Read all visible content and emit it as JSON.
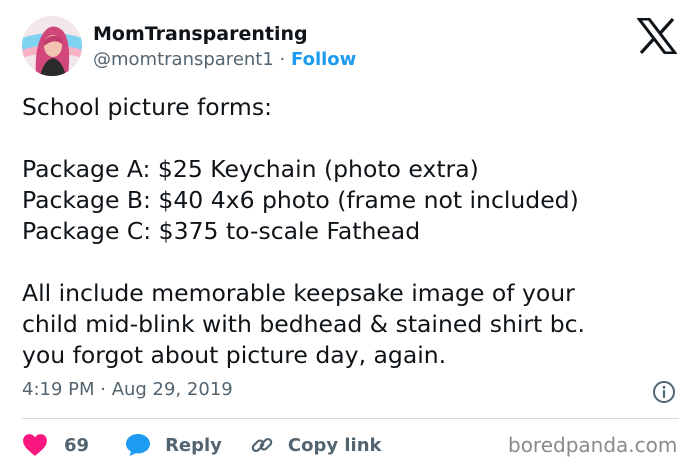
{
  "author": {
    "display_name": "MomTransparenting",
    "handle": "@momtransparent1",
    "separator": "·",
    "follow_label": "Follow",
    "avatar_icon": "profile-photo-avatar"
  },
  "tweet": {
    "lines": [
      "School picture forms:",
      "",
      "Package A: $25 Keychain (photo extra)",
      "Package B: $40 4x6 photo (frame not included)",
      "Package C: $375 to-scale Fathead",
      "",
      "All include memorable keepsake image of your",
      "child mid-blink with bedhead & stained shirt bc.",
      "you forgot about picture day, again."
    ],
    "timestamp": "4:19 PM · Aug 29, 2019"
  },
  "actions": {
    "like_count": "69",
    "reply_label": "Reply",
    "copy_link_label": "Copy link"
  },
  "icons": {
    "brand": "x-logo-icon",
    "info": "info-icon",
    "like": "heart-icon",
    "reply": "reply-bubble-icon",
    "copy": "link-icon"
  },
  "colors": {
    "text": "#0f1419",
    "secondary": "#536471",
    "accent": "#1d9bf0",
    "like": "#f91880",
    "divider": "#cfd9de"
  },
  "watermark": "boredpanda.com"
}
